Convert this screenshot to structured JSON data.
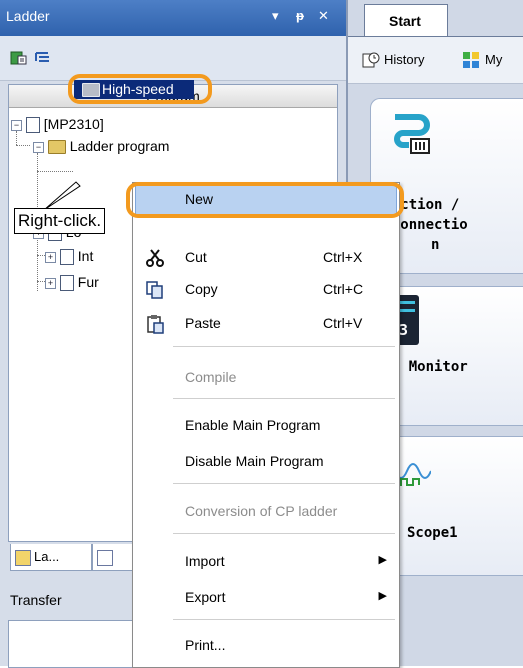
{
  "ladder_panel": {
    "title": "Ladder",
    "controls": {
      "dropdown": "▾",
      "pin": "ᵽ",
      "close": "✕"
    },
    "tree_header": "Program",
    "tree": {
      "root": "[MP2310]",
      "ladder_program": "Ladder program",
      "high_speed": "High-speed",
      "low_prefix": "Lo",
      "int_prefix": "Int",
      "fun_prefix": "Fur"
    },
    "callout": "Right-click.",
    "bottom_tabs": [
      "La...",
      ""
    ],
    "transfer_label": "Transfer"
  },
  "start_panel": {
    "tab": "Start",
    "history": "History",
    "my": "My",
    "tiles": [
      {
        "label_lines": [
          "nnection /",
          "isconnectio",
          "n"
        ]
      },
      {
        "label_lines": [
          "xis Monitor"
        ],
        "icon_text": "123"
      },
      {
        "label_lines": [
          "Scope1"
        ]
      }
    ]
  },
  "context_menu": {
    "items": [
      {
        "label": "New",
        "shortcut": "",
        "highlighted": true
      },
      {
        "label": "Cut",
        "shortcut": "Ctrl+X"
      },
      {
        "label": "Copy",
        "shortcut": "Ctrl+C"
      },
      {
        "label": "Paste",
        "shortcut": "Ctrl+V"
      },
      {
        "label": "Compile",
        "disabled": true
      },
      {
        "label": "Enable Main Program"
      },
      {
        "label": "Disable Main Program"
      },
      {
        "label": "Conversion of CP ladder",
        "disabled": true
      },
      {
        "label": "Import",
        "submenu": true
      },
      {
        "label": "Export",
        "submenu": true
      },
      {
        "label": "Print..."
      }
    ],
    "submenu_arrow": "▶"
  },
  "colors": {
    "highlight_oval": "#f39a1e",
    "selected_row": "#0b2a79",
    "menu_highlight": "#b9d2f1"
  }
}
